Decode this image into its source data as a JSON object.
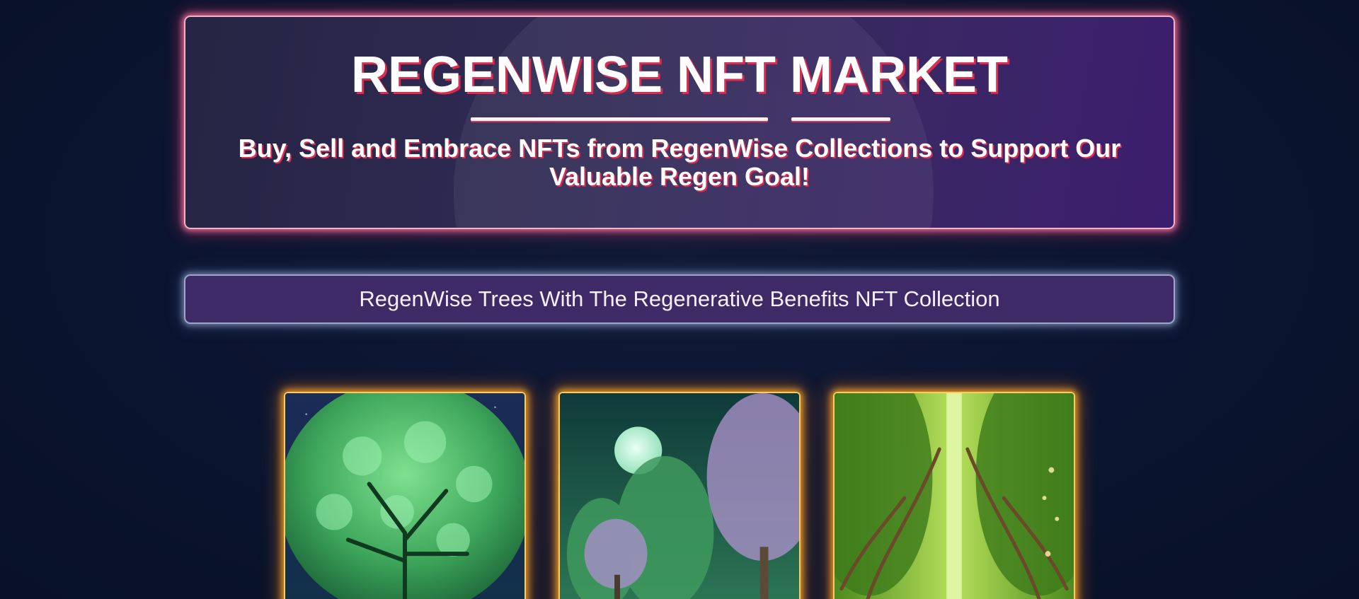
{
  "hero": {
    "title": "REGENWISE NFT MARKET",
    "subtitle": "Buy, Sell and Embrace NFTs from RegenWise Collections to Support Our Valuable Regen Goal!"
  },
  "collection": {
    "title": "RegenWise Trees With The Regenerative Benefits NFT Collection"
  },
  "nfts": [
    {
      "image": "glowing-green-tree-night-icon"
    },
    {
      "image": "moonlit-forest-icon"
    },
    {
      "image": "tree-tunnel-path-icon"
    }
  ],
  "colors": {
    "hero_glow": "#e0294c",
    "bar_bg": "#3e2a66",
    "card_glow": "#ffb032",
    "page_bg": "#0c1530"
  }
}
